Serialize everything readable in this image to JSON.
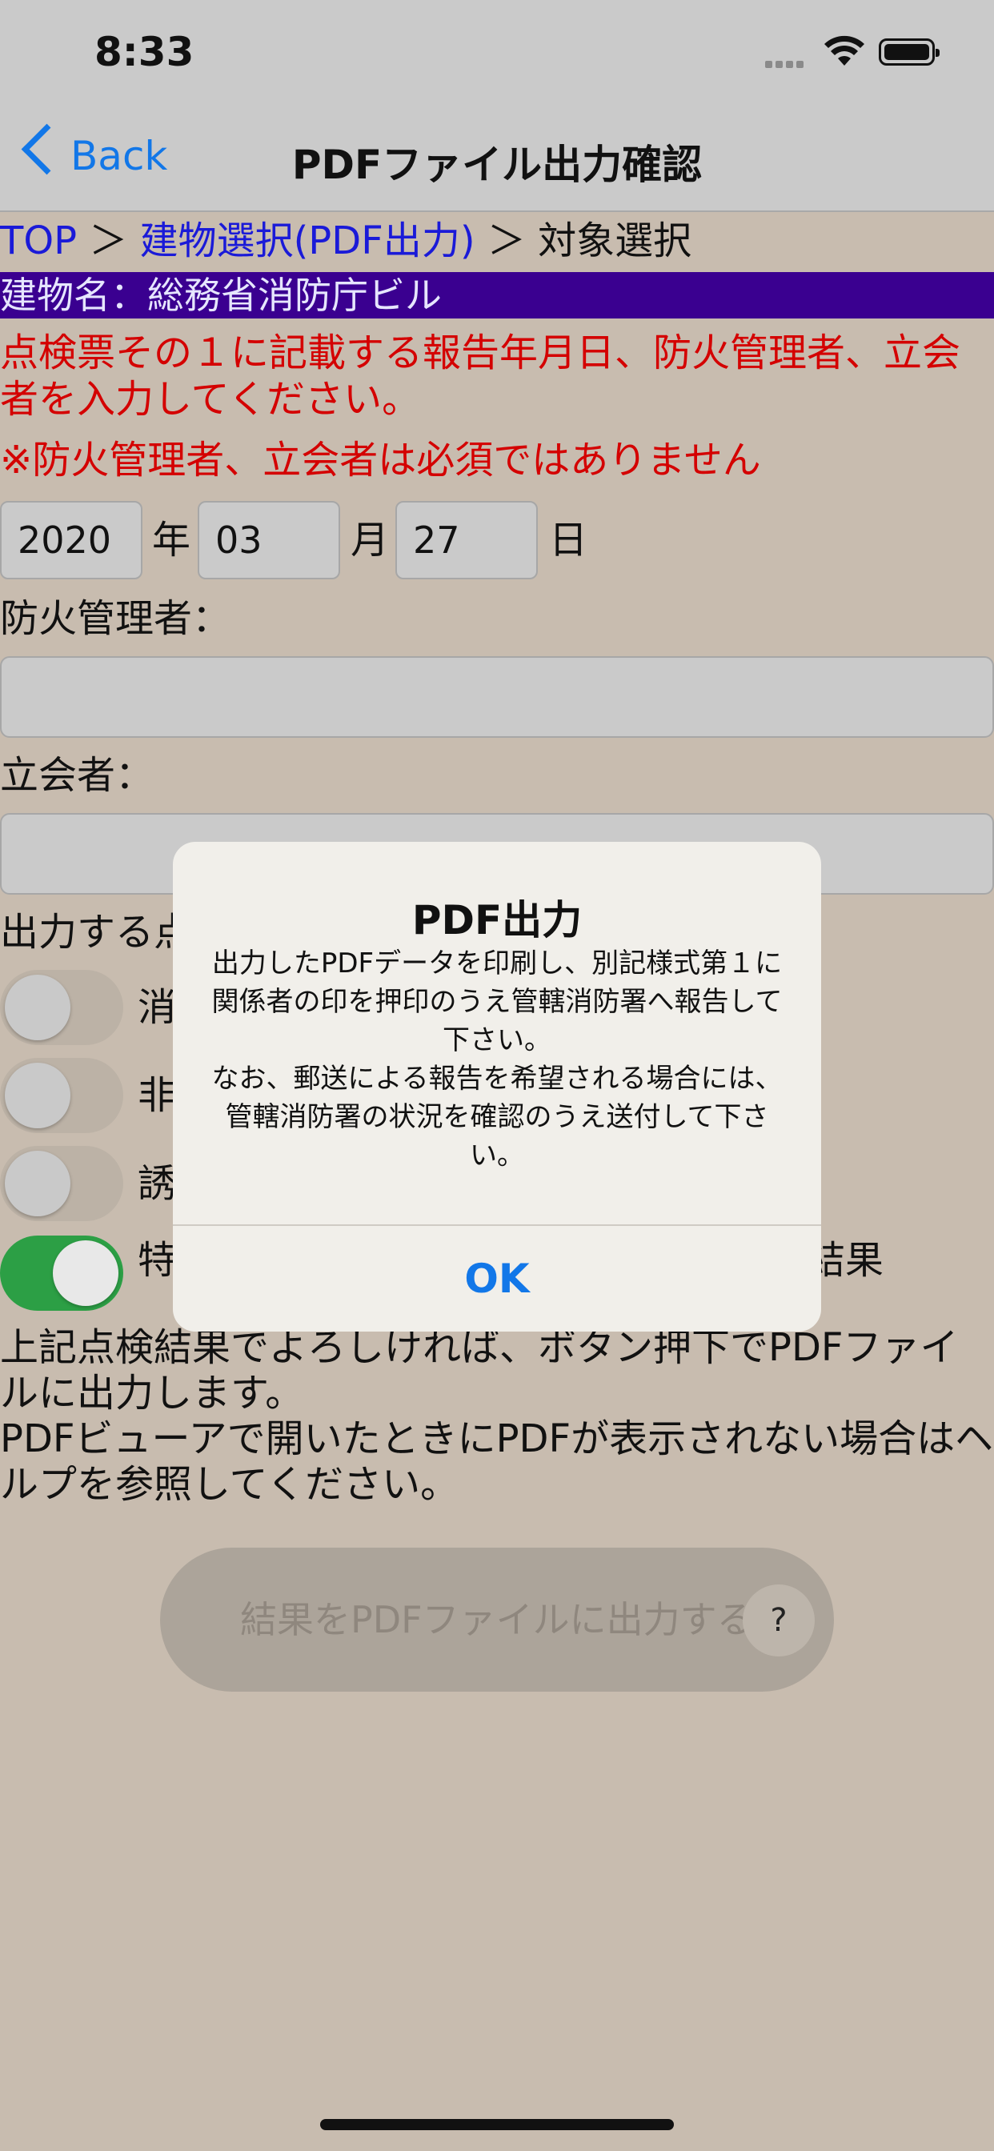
{
  "status_bar": {
    "time": "8:33",
    "wifi_icon": "wifi-icon",
    "battery_icon": "battery-icon"
  },
  "nav": {
    "back_label": "Back",
    "title": "PDFファイル出力確認"
  },
  "breadcrumb": {
    "top": "TOP",
    "sep1": " ＞ ",
    "building_select": "建物選択(PDF出力)",
    "sep2": " ＞ ",
    "current": "対象選択"
  },
  "building": {
    "label": "建物名：",
    "name": "総務省消防庁ビル",
    "bar_color": "#3a0090"
  },
  "instruction": "点検票その１に記載する報告年月日、防火管理者、立会者を入力してください。",
  "note": "※防火管理者、立会者は必須ではありません",
  "date": {
    "year": "2020",
    "year_unit": "年",
    "month": "03",
    "month_unit": "月",
    "day": "27",
    "day_unit": "日"
  },
  "fire_manager": {
    "label": "防火管理者：",
    "value": ""
  },
  "attendee": {
    "label": "立会者：",
    "value": ""
  },
  "output_section_label": "出力する点",
  "toggles": [
    {
      "label": "消",
      "on": false
    },
    {
      "label": "非",
      "on": false
    },
    {
      "label": "誘",
      "on": false
    },
    {
      "label": "特",
      "label_right": "検結果",
      "on": true
    }
  ],
  "body_text_1": "上記点検結果でよろしければ、ボタン押下でPDFファイルに出力します。",
  "body_text_2": "PDFビューアで開いたときにPDFが表示されない場合はヘルプを参照してください。",
  "pdf_button": {
    "label": "結果をPDFファイルに出力する",
    "help_label": "?"
  },
  "alert": {
    "title": "PDF出力",
    "message_1": "出力したPDFデータを印刷し、別記様式第１に関係者の印を押印のうえ管轄消防署へ報告して下さい。",
    "message_2": "なお、郵送による報告を希望される場合には、管轄消防署の状況を確認のうえ送付して下さい。",
    "ok_label": "OK"
  },
  "colors": {
    "accent": "#1277e8",
    "warning_text": "#d40000",
    "link": "#1a1ad8",
    "toggle_on": "#2c9f45",
    "background": "#c8bcaf"
  }
}
